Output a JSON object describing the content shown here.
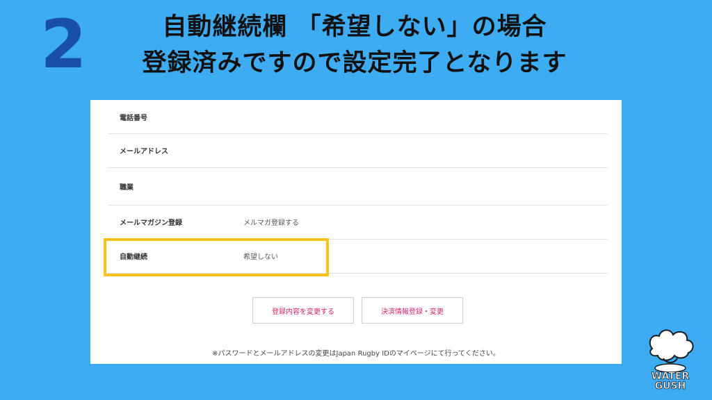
{
  "step": {
    "number": "2"
  },
  "title": {
    "line1": "自動継続欄 「希望しない」の場合",
    "line2": "登録済みですので設定完了となります"
  },
  "form": {
    "rows": [
      {
        "label": "電話番号",
        "value": ""
      },
      {
        "label": "メールアドレス",
        "value": ""
      },
      {
        "label": "職業",
        "value": ""
      },
      {
        "label": "メールマガジン登録",
        "value": "メルマガ登録する"
      },
      {
        "label": "自動継続",
        "value": "希望しない"
      }
    ],
    "buttons": {
      "edit": "登録内容を変更する",
      "payment": "決済情報登録・変更"
    },
    "note": "※パスワードとメールアドレスの変更はJapan Rugby IDのマイページにて行ってください。"
  },
  "logo": {
    "line1": "WATER",
    "line2": "GUSH",
    "icon": "splash-logo-icon"
  },
  "colors": {
    "background": "#3eacf2",
    "step_number": "#1a4fa8",
    "highlight": "#f7c21b",
    "button_text": "#d6246a"
  }
}
